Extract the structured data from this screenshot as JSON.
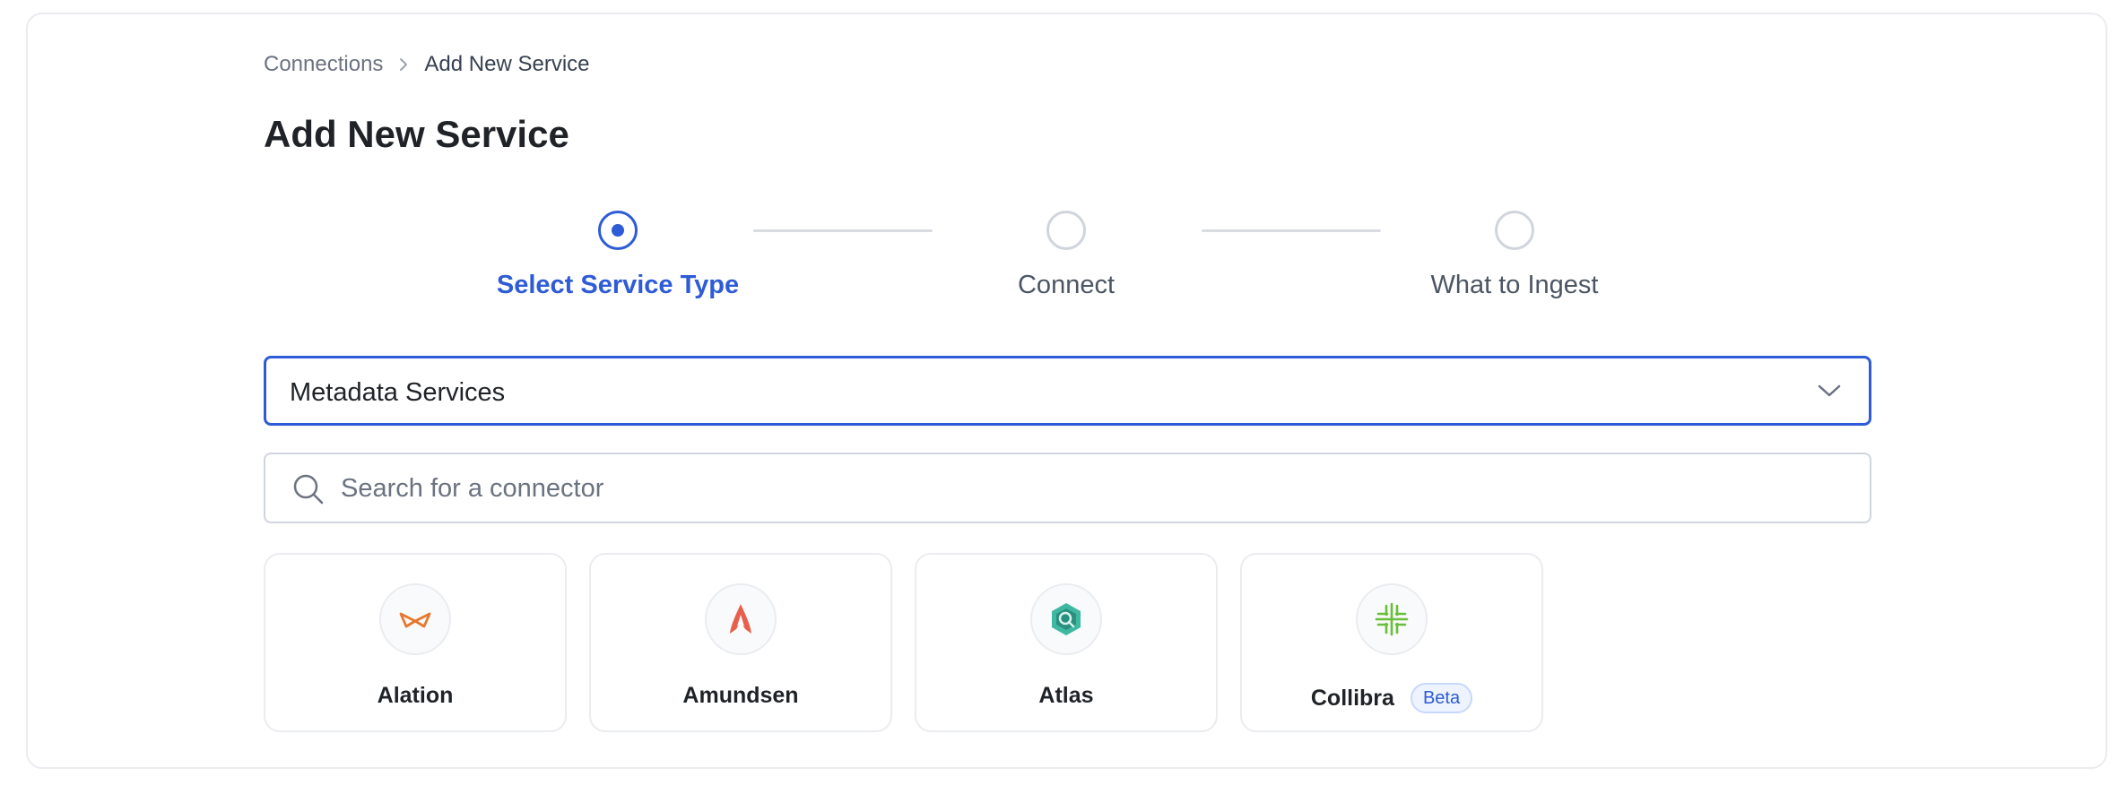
{
  "breadcrumb": {
    "parent": "Connections",
    "current": "Add New Service"
  },
  "page": {
    "title": "Add New Service"
  },
  "stepper": {
    "steps": [
      {
        "label": "Select Service Type",
        "state": "active"
      },
      {
        "label": "Connect",
        "state": "pending"
      },
      {
        "label": "What to Ingest",
        "state": "pending"
      }
    ]
  },
  "service_select": {
    "value": "Metadata Services"
  },
  "search": {
    "placeholder": "Search for a connector",
    "value": ""
  },
  "connectors": [
    {
      "name": "Alation",
      "icon": "alation-logo-icon",
      "badge": ""
    },
    {
      "name": "Amundsen",
      "icon": "amundsen-logo-icon",
      "badge": ""
    },
    {
      "name": "Atlas",
      "icon": "atlas-logo-icon",
      "badge": ""
    },
    {
      "name": "Collibra",
      "icon": "collibra-logo-icon",
      "badge": "Beta"
    }
  ],
  "colors": {
    "accent": "#2e5bd6",
    "border": "#eaecf0",
    "alation": "#e8772e",
    "amundsen": "#e8604c",
    "atlas": "#3fb8a2",
    "collibra": "#6abf3a"
  }
}
